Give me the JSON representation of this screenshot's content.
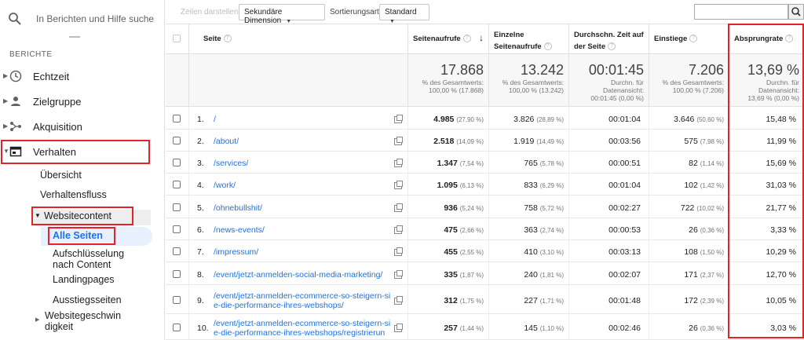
{
  "sidebar": {
    "search_placeholder": "In Berichten und Hilfe suche",
    "section_label": "BERICHTE",
    "items": [
      {
        "label": "Echtzeit"
      },
      {
        "label": "Zielgruppe"
      },
      {
        "label": "Akquisition"
      },
      {
        "label": "Verhalten"
      }
    ],
    "sub_items": {
      "uebersicht": "Übersicht",
      "verhaltensfluss": "Verhaltensfluss",
      "websitecontent": "Websitecontent",
      "alle_seiten": "Alle Seiten",
      "aufschluesselung_1": "Aufschlüsselung",
      "aufschluesselung_2": "nach Content",
      "landingpages": "Landingpages",
      "ausstiegsseiten": "Ausstiegsseiten",
      "websitegeschwindigkeit_1": "Websitegeschwin",
      "websitegeschwindigkeit_2": "digkeit"
    }
  },
  "toolbar": {
    "zeilen_darstellen": "Zeilen darstellen",
    "sekundaere_dimension": "Sekundäre Dimension",
    "sortierungsart_label": "Sortierungsart:",
    "sortierungsart_value": "Standard"
  },
  "table": {
    "headers": {
      "seite": "Seite",
      "seitenaufrufe": "Seitenaufrufe",
      "einzelne_1": "Einzelne",
      "einzelne_2": "Seitenaufrufe",
      "zeit_1": "Durchschn. Zeit auf",
      "zeit_2": "der Seite",
      "einstiege": "Einstiege",
      "absprungrate": "Absprungrate"
    },
    "totals": {
      "seitenaufrufe": {
        "big": "17.868",
        "l1": "% des Gesamtwerts:",
        "l2": "100,00 % (17.868)"
      },
      "einzelne": {
        "big": "13.242",
        "l1": "% des Gesamtwerts:",
        "l2": "100,00 % (13.242)"
      },
      "zeit": {
        "big": "00:01:45",
        "l1": "Durchn. für",
        "l2": "Datenansicht:",
        "l3": "00:01:45 (0,00 %)"
      },
      "einstiege": {
        "big": "7.206",
        "l1": "% des Gesamtwerts:",
        "l2": "100,00 % (7.206)"
      },
      "absprungrate": {
        "big": "13,69 %",
        "l1": "Durchn. für",
        "l2": "Datenansicht:",
        "l3": "13,69 % (0,00 %)"
      }
    },
    "rows": [
      {
        "n": "1.",
        "page": "/",
        "page2": "",
        "sa": "4.985",
        "sa_p": "(27,90 %)",
        "es": "3.826",
        "es_p": "(28,89 %)",
        "zeit": "00:01:04",
        "ein": "3.646",
        "ein_p": "(50,60 %)",
        "ab": "15,48 %"
      },
      {
        "n": "2.",
        "page": "/about/",
        "page2": "",
        "sa": "2.518",
        "sa_p": "(14,09 %)",
        "es": "1.919",
        "es_p": "(14,49 %)",
        "zeit": "00:03:56",
        "ein": "575",
        "ein_p": "(7,98 %)",
        "ab": "11,99 %"
      },
      {
        "n": "3.",
        "page": "/services/",
        "page2": "",
        "sa": "1.347",
        "sa_p": "(7,54 %)",
        "es": "765",
        "es_p": "(5,78 %)",
        "zeit": "00:00:51",
        "ein": "82",
        "ein_p": "(1,14 %)",
        "ab": "15,69 %"
      },
      {
        "n": "4.",
        "page": "/work/",
        "page2": "",
        "sa": "1.095",
        "sa_p": "(6,13 %)",
        "es": "833",
        "es_p": "(6,29 %)",
        "zeit": "00:01:04",
        "ein": "102",
        "ein_p": "(1,42 %)",
        "ab": "31,03 %"
      },
      {
        "n": "5.",
        "page": "/ohnebullshit/",
        "page2": "",
        "sa": "936",
        "sa_p": "(5,24 %)",
        "es": "758",
        "es_p": "(5,72 %)",
        "zeit": "00:02:27",
        "ein": "722",
        "ein_p": "(10,02 %)",
        "ab": "21,77 %"
      },
      {
        "n": "6.",
        "page": "/news-events/",
        "page2": "",
        "sa": "475",
        "sa_p": "(2,66 %)",
        "es": "363",
        "es_p": "(2,74 %)",
        "zeit": "00:00:53",
        "ein": "26",
        "ein_p": "(0,36 %)",
        "ab": "3,33 %"
      },
      {
        "n": "7.",
        "page": "/impressum/",
        "page2": "",
        "sa": "455",
        "sa_p": "(2,55 %)",
        "es": "410",
        "es_p": "(3,10 %)",
        "zeit": "00:03:13",
        "ein": "108",
        "ein_p": "(1,50 %)",
        "ab": "10,29 %"
      },
      {
        "n": "8.",
        "page": "/event/jetzt-anmelden-social-media-marketing/",
        "page2": "",
        "sa": "335",
        "sa_p": "(1,87 %)",
        "es": "240",
        "es_p": "(1,81 %)",
        "zeit": "00:02:07",
        "ein": "171",
        "ein_p": "(2,37 %)",
        "ab": "12,70 %"
      },
      {
        "n": "9.",
        "page": "/event/jetzt-anmelden-ecommerce-so-steigern-si",
        "page2": "e-die-performance-ihres-webshops/",
        "sa": "312",
        "sa_p": "(1,75 %)",
        "es": "227",
        "es_p": "(1,71 %)",
        "zeit": "00:01:48",
        "ein": "172",
        "ein_p": "(2,39 %)",
        "ab": "10,05 %"
      },
      {
        "n": "10.",
        "page": "/event/jetzt-anmelden-ecommerce-so-steigern-si",
        "page2": "e-die-performance-ihres-webshops/registrierun",
        "sa": "257",
        "sa_p": "(1,44 %)",
        "es": "145",
        "es_p": "(1,10 %)",
        "zeit": "00:02:46",
        "ein": "26",
        "ein_p": "(0,36 %)",
        "ab": "3,03 %"
      }
    ]
  },
  "colors": {
    "accent": "#1a73e8",
    "highlight": "#e2232a"
  }
}
